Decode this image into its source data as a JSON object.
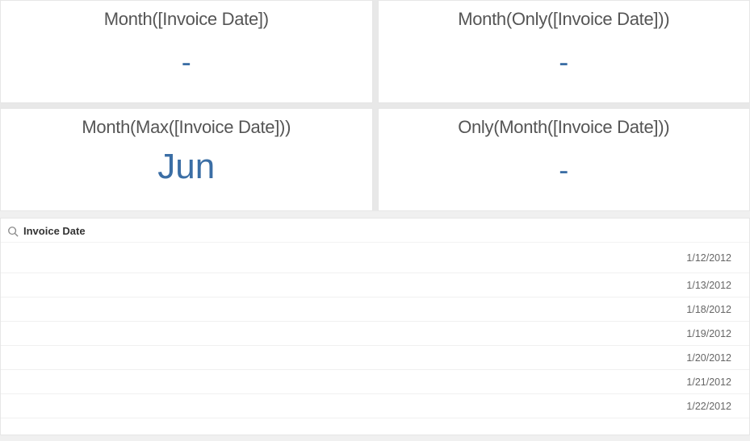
{
  "kpis": [
    {
      "title": "Month([Invoice Date])",
      "value": "-"
    },
    {
      "title": "Month(Only([Invoice Date]))",
      "value": "-"
    },
    {
      "title": "Month(Max([Invoice Date]))",
      "value": "Jun"
    },
    {
      "title": "Only(Month([Invoice Date]))",
      "value": "-"
    }
  ],
  "list": {
    "title": "Invoice Date",
    "items": [
      "1/12/2012",
      "1/13/2012",
      "1/18/2012",
      "1/19/2012",
      "1/20/2012",
      "1/21/2012",
      "1/22/2012"
    ]
  }
}
